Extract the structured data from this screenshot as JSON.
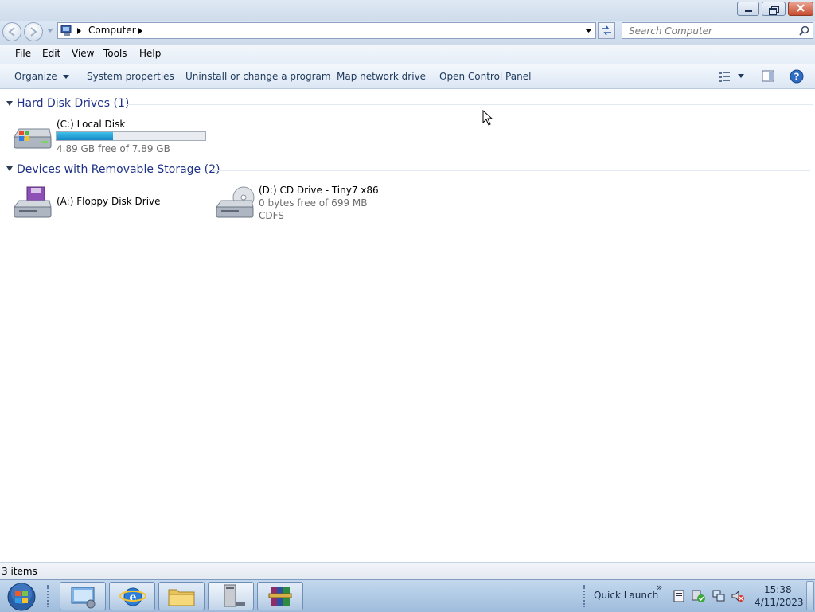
{
  "window": {
    "caption_buttons": [
      "minimize",
      "restore",
      "close"
    ]
  },
  "navigation": {
    "address_segments": [
      "Computer"
    ],
    "search_placeholder": "Search Computer"
  },
  "menu": {
    "items": [
      "File",
      "Edit",
      "View",
      "Tools",
      "Help"
    ]
  },
  "commands": {
    "organize": "Organize",
    "system_properties": "System properties",
    "uninstall": "Uninstall or change a program",
    "map_drive": "Map network drive",
    "control_panel": "Open Control Panel"
  },
  "groups": {
    "hdd": {
      "title": "Hard Disk Drives (1)",
      "items": [
        {
          "name": "(C:) Local Disk",
          "detail": "4.89 GB free of 7.89 GB",
          "used_fraction": 0.38,
          "icon": "hard-drive-icon"
        }
      ]
    },
    "removable": {
      "title": "Devices with Removable Storage (2)",
      "items": [
        {
          "name": "(A:) Floppy Disk Drive",
          "icon": "floppy-drive-icon"
        },
        {
          "name": "(D:) CD Drive - Tiny7 x86",
          "detail": "0 bytes free of 699 MB",
          "filesystem": "CDFS",
          "icon": "cd-drive-icon"
        }
      ]
    }
  },
  "status": {
    "item_count": "3 items"
  },
  "taskbar": {
    "quick_launch": "Quick Launch",
    "time": "15:38",
    "date": "4/11/2023",
    "overflow": "»"
  },
  "colors": {
    "accent": "#1e3287",
    "progress": "#25a0da",
    "taskbar": "#a9c3e0"
  }
}
